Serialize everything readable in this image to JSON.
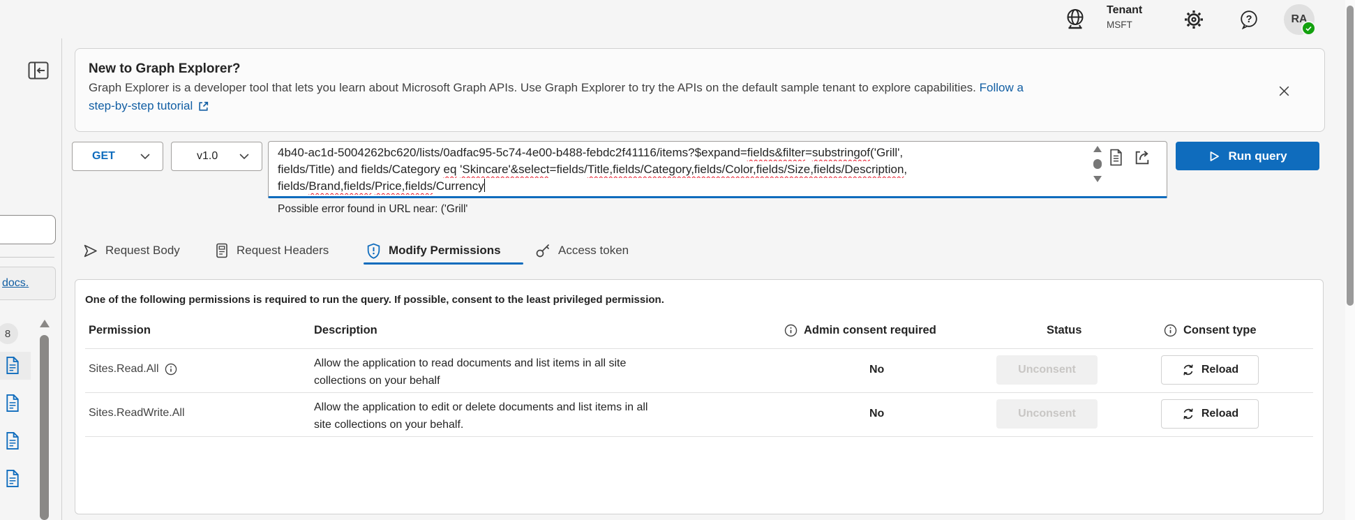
{
  "topbar": {
    "tenant_label": "Tenant",
    "tenant_value": "MSFT",
    "avatar_initials": "RA"
  },
  "sidebar": {
    "docs_link": "docs.",
    "badge_count": "8"
  },
  "banner": {
    "title": "New to Graph Explorer?",
    "description": "Graph Explorer is a developer tool that lets you learn about Microsoft Graph APIs. Use Graph Explorer to try the APIs on the default sample tenant to explore capabilities.",
    "link_inline": "Follow a",
    "link_line2": "step-by-step tutorial"
  },
  "query": {
    "method": "GET",
    "version": "v1.0",
    "run_label": "Run query",
    "error_text": "Possible error found in URL near: ('Grill'",
    "url_lines": [
      [
        {
          "text": "4b40-ac1d-5004262bc620/lists/0adfac95-5c74-4e00-b488-febdc2f41116/items?$expand=",
          "wavy": false
        },
        {
          "text": "fields&filter",
          "wavy": true
        },
        {
          "text": "=",
          "wavy": false
        },
        {
          "text": "substringof",
          "wavy": true
        },
        {
          "text": "('Grill',",
          "wavy": false
        }
      ],
      [
        {
          "text": "fields/Title) and fields/Category ",
          "wavy": false
        },
        {
          "text": "eq",
          "wavy": true
        },
        {
          "text": " ",
          "wavy": false
        },
        {
          "text": "'Skincare'&select",
          "wavy": true
        },
        {
          "text": "=fields/",
          "wavy": false
        },
        {
          "text": "Title,fields/Category,fields/Color,fields/Size,fields/Description",
          "wavy": true
        },
        {
          "text": ",",
          "wavy": false
        }
      ],
      [
        {
          "text": "fields/",
          "wavy": false
        },
        {
          "text": "Brand,fields",
          "wavy": true
        },
        {
          "text": "/",
          "wavy": false
        },
        {
          "text": "Price,fields",
          "wavy": true
        },
        {
          "text": "/Currency",
          "wavy": false
        }
      ]
    ]
  },
  "tabs": [
    {
      "label": "Request Body",
      "active": false
    },
    {
      "label": "Request Headers",
      "active": false
    },
    {
      "label": "Modify Permissions",
      "active": true
    },
    {
      "label": "Access token",
      "active": false
    }
  ],
  "permissions": {
    "intro": "One of the following permissions is required to run the query. If possible, consent to the least privileged permission.",
    "headers": {
      "permission": "Permission",
      "description": "Description",
      "admin_consent": "Admin consent required",
      "status": "Status",
      "consent_type": "Consent type"
    },
    "rows": [
      {
        "permission": "Sites.Read.All",
        "description_lines": [
          "Allow the application to read documents and list items in all site",
          "collections on your behalf"
        ],
        "admin_consent": "No",
        "status_action": "Unconsent",
        "consent_action": "Reload"
      },
      {
        "permission": "Sites.ReadWrite.All",
        "description_lines": [
          "Allow the application to edit or delete documents and list items in all",
          "site collections on your behalf."
        ],
        "admin_consent": "No",
        "status_action": "Unconsent",
        "consent_action": "Reload"
      }
    ]
  },
  "colors": {
    "accent_blue": "#0f6cbd",
    "link_blue": "#115ea3",
    "squiggle_red": "#e81123",
    "badge_green": "#13a10e"
  }
}
